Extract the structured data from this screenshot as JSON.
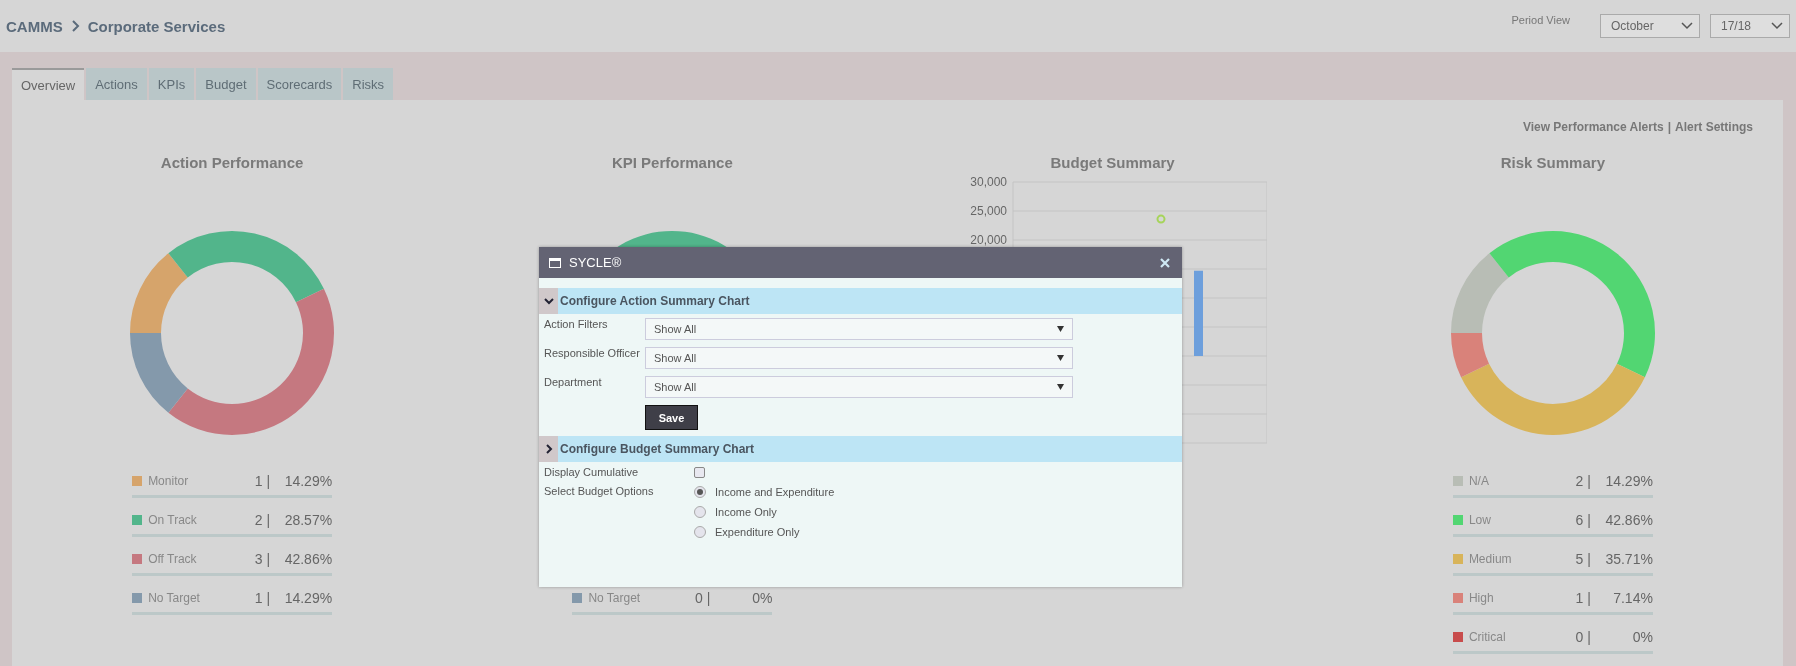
{
  "breadcrumb": {
    "root": "CAMMS",
    "current": "Corporate Services"
  },
  "period": {
    "label": "Period View",
    "month": "October",
    "year": "17/18"
  },
  "tabs": [
    {
      "label": "Overview",
      "selected": true
    },
    {
      "label": "Actions",
      "selected": false
    },
    {
      "label": "KPIs",
      "selected": false
    },
    {
      "label": "Budget",
      "selected": false
    },
    {
      "label": "Scorecards",
      "selected": false
    },
    {
      "label": "Risks",
      "selected": false
    }
  ],
  "alerts": {
    "links": [
      "View Performance Alerts",
      "Alert Settings"
    ],
    "separator": "|"
  },
  "panels": [
    {
      "kind": "chart",
      "chart_data": {
        "type": "donut",
        "title": "Action Performance",
        "categories": [
          "Monitor",
          "On Track",
          "Off Track",
          "No Target"
        ],
        "values": [
          14.29,
          28.57,
          42.86,
          14.29
        ]
      },
      "legend": [
        {
          "count": "1 |",
          "percent": "14.29%",
          "color": "#d6a46b"
        },
        {
          "count": "2 |",
          "percent": "28.57%",
          "color": "#52b58b"
        },
        {
          "count": "3 |",
          "percent": "42.86%",
          "color": "#c57880"
        },
        {
          "count": "1 |",
          "percent": "14.29%",
          "color": "#8499ab"
        }
      ]
    },
    {
      "kind": "ring",
      "title": "KPI Performance",
      "color": "#52b58b",
      "legend": [
        {
          "label": "No Target",
          "count": "0 |",
          "percent": "0%",
          "color": "#8499ab"
        }
      ]
    },
    {
      "kind": "chart",
      "chart_data": {
        "type": "bar",
        "title": "Budget Summary",
        "ylim": [
          -15000,
          30000
        ],
        "yticks": [
          {
            "value": 30000,
            "label": "30,000"
          },
          {
            "value": 25000,
            "label": "25,000"
          },
          {
            "value": 20000,
            "label": "20,000"
          }
        ],
        "series": [
          {
            "color": "#6d9fdc",
            "values": [
              14700
            ]
          },
          {
            "type": "scatter",
            "color": "#a6d45a",
            "values": [
              23600
            ]
          }
        ]
      }
    },
    {
      "kind": "chart",
      "chart_data": {
        "type": "donut",
        "title": "Risk Summary",
        "categories": [
          "N/A",
          "Low",
          "Medium",
          "High",
          "Critical"
        ],
        "values": [
          14.29,
          42.86,
          35.71,
          7.14,
          0
        ]
      },
      "legend": [
        {
          "count": "2 |",
          "percent": "14.29%",
          "color": "#b8bdb5"
        },
        {
          "count": "6 |",
          "percent": "42.86%",
          "color": "#52d672"
        },
        {
          "count": "5 |",
          "percent": "35.71%",
          "color": "#d8b45a"
        },
        {
          "count": "1 |",
          "percent": "7.14%",
          "color": "#d9827a"
        },
        {
          "count": "0 |",
          "percent": "0%",
          "color": "#c84c4c"
        }
      ]
    }
  ],
  "dialog": {
    "title": "SYCLE®",
    "sections": [
      {
        "title": "Configure Action Summary Chart",
        "expanded": true,
        "fields": [
          {
            "kind": "select",
            "label": "Action Filters",
            "value": "Show All"
          },
          {
            "kind": "select",
            "label": "Responsible Officer",
            "value": "Show All"
          },
          {
            "kind": "select",
            "label": "Department",
            "value": "Show All"
          },
          {
            "kind": "button",
            "label": "Save"
          }
        ]
      },
      {
        "title": "Configure Budget Summary Chart",
        "expanded": false,
        "fields": [
          {
            "kind": "checkbox",
            "label": "Display Cumulative",
            "checked": false
          },
          {
            "kind": "radio",
            "label": "Select Budget Options",
            "options": [
              {
                "label": "Income and Expenditure",
                "selected": true
              },
              {
                "label": "Income Only",
                "selected": false
              },
              {
                "label": "Expenditure Only",
                "selected": false
              }
            ]
          }
        ]
      }
    ]
  }
}
